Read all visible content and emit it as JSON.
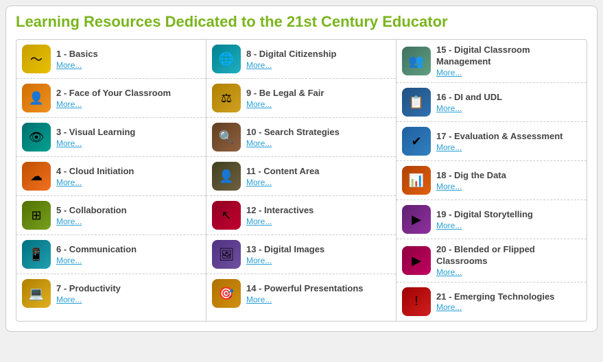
{
  "page": {
    "title": "Learning Resources Dedicated to the 21st Century Educator"
  },
  "columns": [
    {
      "items": [
        {
          "id": "1",
          "name": "1 - Basics",
          "link": "More...",
          "iconClass": "ic-yellow-wave",
          "iconSymbol": "〜"
        },
        {
          "id": "2",
          "name": "2 - Face of Your Classroom",
          "link": "More...",
          "iconClass": "ic-orange-person",
          "iconSymbol": "👤"
        },
        {
          "id": "3",
          "name": "3 - Visual Learning",
          "link": "More...",
          "iconClass": "ic-teal-eye",
          "iconSymbol": "👁"
        },
        {
          "id": "4",
          "name": "4 - Cloud Initiation",
          "link": "More...",
          "iconClass": "ic-orange-sun",
          "iconSymbol": "☁"
        },
        {
          "id": "5",
          "name": "5 - Collaboration",
          "link": "More...",
          "iconClass": "ic-green-collab",
          "iconSymbol": "⊞"
        },
        {
          "id": "6",
          "name": "6 - Communication",
          "link": "More...",
          "iconClass": "ic-teal-comm",
          "iconSymbol": "📱"
        },
        {
          "id": "7",
          "name": "7 - Productivity",
          "link": "More...",
          "iconClass": "ic-gold-laptop",
          "iconSymbol": "💻"
        }
      ]
    },
    {
      "items": [
        {
          "id": "8",
          "name": "8 - Digital Citizenship",
          "link": "More...",
          "iconClass": "ic-teal-globe",
          "iconSymbol": "🌐"
        },
        {
          "id": "9",
          "name": "9 - Be Legal & Fair",
          "link": "More...",
          "iconClass": "ic-gold-scale",
          "iconSymbol": "⚖"
        },
        {
          "id": "10",
          "name": "10 - Search Strategies",
          "link": "More...",
          "iconClass": "ic-brown-search",
          "iconSymbol": "🔍"
        },
        {
          "id": "11",
          "name": "11 - Content Area",
          "link": "More...",
          "iconClass": "ic-dark-person",
          "iconSymbol": "👤"
        },
        {
          "id": "12",
          "name": "12 - Interactives",
          "link": "More...",
          "iconClass": "ic-red-cursor",
          "iconSymbol": "↖"
        },
        {
          "id": "13",
          "name": "13 - Digital Images",
          "link": "More...",
          "iconClass": "ic-purple-img",
          "iconSymbol": "🖼"
        },
        {
          "id": "14",
          "name": "14 - Powerful Presentations",
          "link": "More...",
          "iconClass": "ic-gold-present",
          "iconSymbol": "🎯"
        }
      ]
    },
    {
      "items": [
        {
          "id": "15",
          "name": "15 - Digital Classroom Management",
          "link": "More...",
          "iconClass": "ic-teal-manage",
          "iconSymbol": "👥"
        },
        {
          "id": "16",
          "name": "16 - DI and UDL",
          "link": "More...",
          "iconClass": "ic-blue-di",
          "iconSymbol": "📋"
        },
        {
          "id": "17",
          "name": "17 - Evaluation & Assessment",
          "link": "More...",
          "iconClass": "ic-blue-check",
          "iconSymbol": "✔"
        },
        {
          "id": "18",
          "name": "18 - Dig the Data",
          "link": "More...",
          "iconClass": "ic-orange-data",
          "iconSymbol": "📊"
        },
        {
          "id": "19",
          "name": "19 - Digital Storytelling",
          "link": "More...",
          "iconClass": "ic-purple-video",
          "iconSymbol": "▶"
        },
        {
          "id": "20",
          "name": "20 - Blended or Flipped Classrooms",
          "link": "More...",
          "iconClass": "ic-red-blended",
          "iconSymbol": "▶"
        },
        {
          "id": "21",
          "name": "21 - Emerging Technologies",
          "link": "More...",
          "iconClass": "ic-red-emerging",
          "iconSymbol": "!"
        }
      ]
    }
  ]
}
